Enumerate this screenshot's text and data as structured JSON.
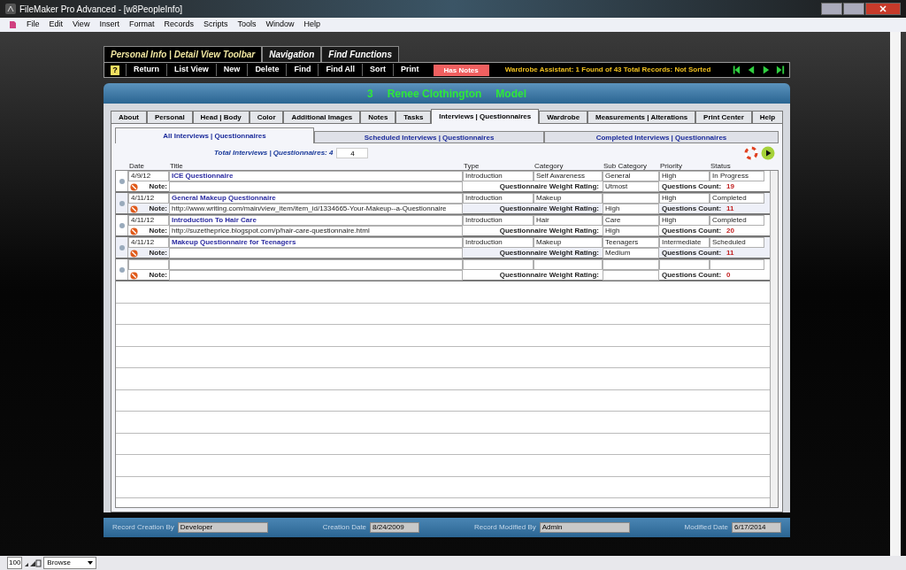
{
  "window": {
    "title": "FileMaker Pro Advanced - [w8PeopleInfo]"
  },
  "menu": [
    "File",
    "Edit",
    "View",
    "Insert",
    "Format",
    "Records",
    "Scripts",
    "Tools",
    "Window",
    "Help"
  ],
  "toolbar_tabs": [
    {
      "label": "Personal Info | Detail View Toolbar",
      "selected": true
    },
    {
      "label": "Navigation",
      "selected": false
    },
    {
      "label": "Find Functions",
      "selected": false
    }
  ],
  "help": "?",
  "toolbar_buttons": [
    "Return",
    "List View",
    "New",
    "Delete",
    "Find",
    "Find All",
    "Sort",
    "Print"
  ],
  "has_notes": "Has Notes",
  "record_status": "Wardrobe Assistant:  1 Found of 43 Total Records: Not Sorted",
  "header": {
    "number": "3",
    "name": "Renee Clothington",
    "role": "Model"
  },
  "layout_tabs": [
    {
      "label": "About",
      "selected": false
    },
    {
      "label": "Personal",
      "selected": false
    },
    {
      "label": "Head | Body",
      "selected": false
    },
    {
      "label": "Color",
      "selected": false
    },
    {
      "label": "Additional Images",
      "selected": false
    },
    {
      "label": "Notes",
      "selected": false
    },
    {
      "label": "Tasks",
      "selected": false
    },
    {
      "label": "Interviews | Questionnaires",
      "selected": true
    },
    {
      "label": "Wardrobe",
      "selected": false
    },
    {
      "label": "Measurements | Alterations",
      "selected": false
    },
    {
      "label": "Print Center",
      "selected": false
    },
    {
      "label": "Help",
      "selected": false
    }
  ],
  "sub_tabs": [
    {
      "label": "All Interviews | Questionnaires",
      "selected": true
    },
    {
      "label": "Scheduled Interviews | Questionnaires",
      "selected": false
    },
    {
      "label": "Completed  Interviews | Questionnaires",
      "selected": false
    }
  ],
  "total": {
    "label": "Total Interviews | Questionnaires: 4",
    "value": "4"
  },
  "columns": [
    "Date",
    "Title",
    "Type",
    "Category",
    "Sub Category",
    "Priority",
    "Status"
  ],
  "rows": [
    {
      "date": "4/9/12",
      "title": "ICE Questionnaire",
      "type": "Introduction",
      "category": "Self Awareness",
      "sub_category": "General",
      "priority": "High",
      "status": "In Progress",
      "note_label": "Note:",
      "weight_label": "Questionnaire Weight Rating:",
      "weight": "Utmost",
      "count_label": "Questions Count:",
      "count": "19"
    },
    {
      "date": "4/11/12",
      "title": "General Makeup Questionnaire",
      "type": "Introduction",
      "category": "Makeup",
      "priority": "High",
      "status": "Completed",
      "note_label": "Note:",
      "note": "http://www.writing.com/main/view_item/item_id/1334665-Your-Makeup--a-Questionnaire",
      "weight_label": "Questionnaire Weight Rating:",
      "weight": "High",
      "count_label": "Questions Count:",
      "count": "11"
    },
    {
      "date": "4/11/12",
      "title": "Introduction To Hair Care",
      "type": "Introduction",
      "category": "Hair",
      "sub_category": "Care",
      "priority": "High",
      "status": "Completed",
      "note_label": "Note:",
      "note": "http://suzetheprice.blogspot.com/p/hair-care-questionnaire.html",
      "weight_label": "Questionnaire Weight Rating:",
      "weight": "High",
      "count_label": "Questions Count:",
      "count": "20"
    },
    {
      "date": "4/11/12",
      "title": "Makeup Questionnaire for Teenagers",
      "type": "Introduction",
      "category": "Makeup",
      "sub_category": "Teenagers",
      "priority": "Intermediate",
      "status": "Scheduled",
      "note_label": "Note:",
      "weight_label": "Questionnaire Weight Rating:",
      "weight": "Medium",
      "count_label": "Questions Count:",
      "count": "11"
    },
    {
      "note_label": "Note:",
      "weight_label": "Questionnaire Weight Rating:",
      "count_label": "Questions Count:",
      "count": "0"
    }
  ],
  "footer": [
    {
      "label": "Record Creation By",
      "value": "Developer"
    },
    {
      "label": "Creation Date",
      "value": "8/24/2009"
    },
    {
      "label": "Record Modified By",
      "value": "Admin"
    },
    {
      "label": "Modified Date",
      "value": "6/17/2014"
    }
  ],
  "status_bar": {
    "zoom": "100",
    "mode": "Browse"
  }
}
